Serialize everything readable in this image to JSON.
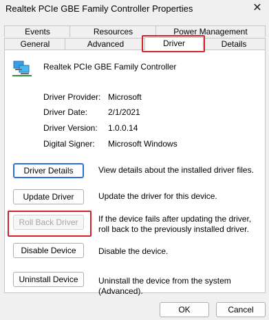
{
  "window": {
    "title": "Realtek PCIe GBE Family Controller Properties"
  },
  "tabs": {
    "row1": [
      "Events",
      "Resources",
      "Power Management"
    ],
    "row2": [
      "General",
      "Advanced",
      "Driver",
      "Details"
    ],
    "selected": "Driver"
  },
  "device": {
    "icon": "network-adapter-icon",
    "name": "Realtek PCIe GBE Family Controller"
  },
  "info": [
    {
      "label": "Driver Provider:",
      "value": "Microsoft"
    },
    {
      "label": "Driver Date:",
      "value": "2/1/2021"
    },
    {
      "label": "Driver Version:",
      "value": "1.0.0.14"
    },
    {
      "label": "Digital Signer:",
      "value": "Microsoft Windows"
    }
  ],
  "actions": [
    {
      "label": "Driver Details",
      "desc": "View details about the installed driver files.",
      "enabled": true
    },
    {
      "label": "Update Driver",
      "desc": "Update the driver for this device.",
      "enabled": true
    },
    {
      "label": "Roll Back Driver",
      "desc": "If the device fails after updating the driver, roll back to the previously installed driver.",
      "enabled": false
    },
    {
      "label": "Disable Device",
      "desc": "Disable the device.",
      "enabled": true
    },
    {
      "label": "Uninstall Device",
      "desc": "Uninstall the device from the system (Advanced).",
      "enabled": true
    }
  ],
  "footer": {
    "ok": "OK",
    "cancel": "Cancel"
  },
  "colors": {
    "highlight": "#d3232a",
    "accent": "#2b6fd6"
  }
}
